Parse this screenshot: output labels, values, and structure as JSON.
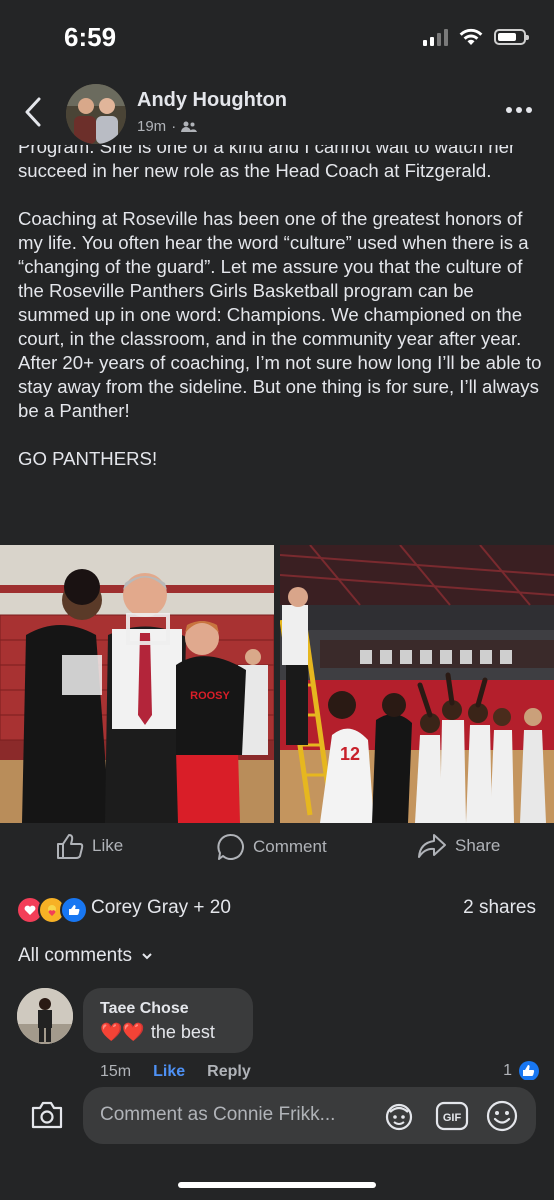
{
  "status_bar": {
    "time": "6:59"
  },
  "header": {
    "author": "Andy Houghton",
    "timestamp": "19m",
    "audience_icon": "friends-icon"
  },
  "post": {
    "paragraphs": [
      "Program.  She is one of a kind and I cannot wait to watch her succeed in her new role as the Head Coach at Fitzgerald.",
      "Coaching at Roseville has been one of the greatest honors of my life. You often hear the word “culture” used when there is a “changing of the guard”. Let me assure you that the culture of the Roseville Panthers Girls Basketball program can be summed up in one word: Champions. We championed on the court, in the classroom, and in the community year after year.  After 20+ years of coaching, I’m not sure how long I’ll be able to stay away from the sideline.  But one thing is for sure, I’ll always be a Panther!",
      "GO PANTHERS!"
    ],
    "photo_shirt_text": "ROOSY",
    "photo_jersey_number": "12"
  },
  "actions": {
    "like": "Like",
    "comment": "Comment",
    "share": "Share"
  },
  "reactions": {
    "names": "Corey Gray + 20",
    "shares": "2 shares",
    "icons": [
      "love-icon",
      "care-icon",
      "like-icon"
    ]
  },
  "comments": {
    "filter_label": "All comments",
    "items": [
      {
        "author": "Taee Chose",
        "text": "the best",
        "emoji": "❤️❤️",
        "time": "15m",
        "like": "Like",
        "reply": "Reply",
        "like_count": "1"
      }
    ]
  },
  "composer": {
    "placeholder": "Comment as Connie Frikk..."
  },
  "colors": {
    "background": "#242526",
    "bubble": "#3a3b3c",
    "accent": "#4e91f5",
    "secondary_text": "#b0b3b8"
  }
}
